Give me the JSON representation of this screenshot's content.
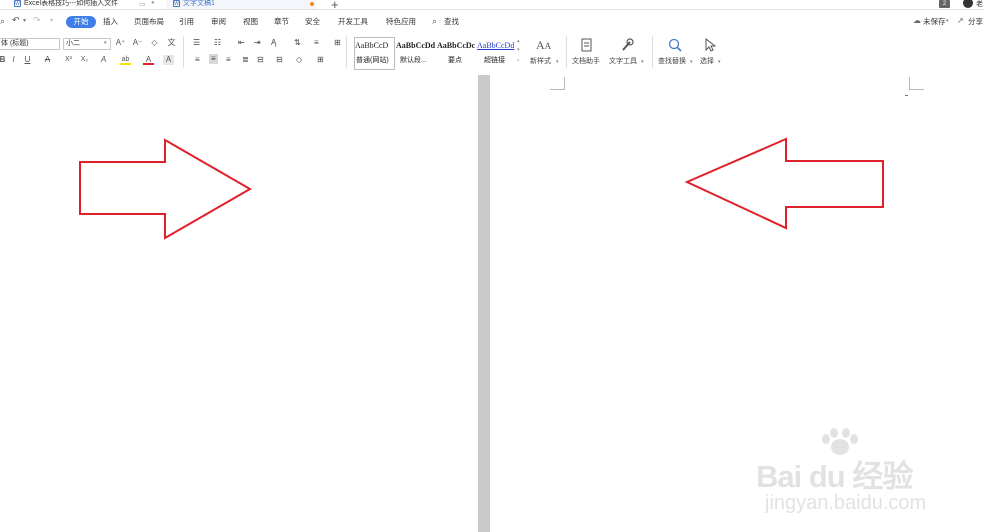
{
  "tabs": [
    {
      "label": "Excel表格技巧---如何插入文件",
      "icon": "wps-doc-icon"
    },
    {
      "label": "文字文稿1",
      "icon": "wps-doc-icon"
    }
  ],
  "window": {
    "new_tab": "+",
    "page_count": "2",
    "user_initial": "老"
  },
  "menu": {
    "items": [
      "开始",
      "插入",
      "页面布局",
      "引用",
      "审阅",
      "视图",
      "章节",
      "安全",
      "开发工具",
      "特色应用"
    ],
    "active": "开始",
    "search": "查找"
  },
  "status": {
    "unsaved": "未保存",
    "share": "分享"
  },
  "font": {
    "family": "体 (标题)",
    "size": "小二"
  },
  "styles": [
    {
      "sample": "AaBbCcD",
      "name": "普通(网站)"
    },
    {
      "sample": "AaBbCcDd",
      "name": "默认段..."
    },
    {
      "sample": "AaBbCcDc",
      "name": "要点"
    },
    {
      "sample": "AaBbCcDd",
      "name": "超链接"
    }
  ],
  "ribbon_buttons": {
    "new_style": "新样式",
    "doc_assistant": "文档助手",
    "text_tools": "文字工具",
    "find_replace": "查找替换",
    "select": "选择"
  },
  "format_glyphs": {
    "bold": "B",
    "italic": "I",
    "underline": "U",
    "strike": "A",
    "superscript": "X²",
    "subscript": "X₂",
    "grow_font": "A⁺",
    "shrink_font": "A⁻",
    "clear_format": "◇",
    "phonetic": "文",
    "highlight": "ab",
    "font_color": "A",
    "char_shade": "A"
  },
  "watermark": {
    "logo": "Bai du 经验",
    "url": "jingyan.baidu.com"
  },
  "colors": {
    "accent": "#3f7ee8",
    "arrow": "#e0202a",
    "gutter": "#c9c9c9"
  }
}
